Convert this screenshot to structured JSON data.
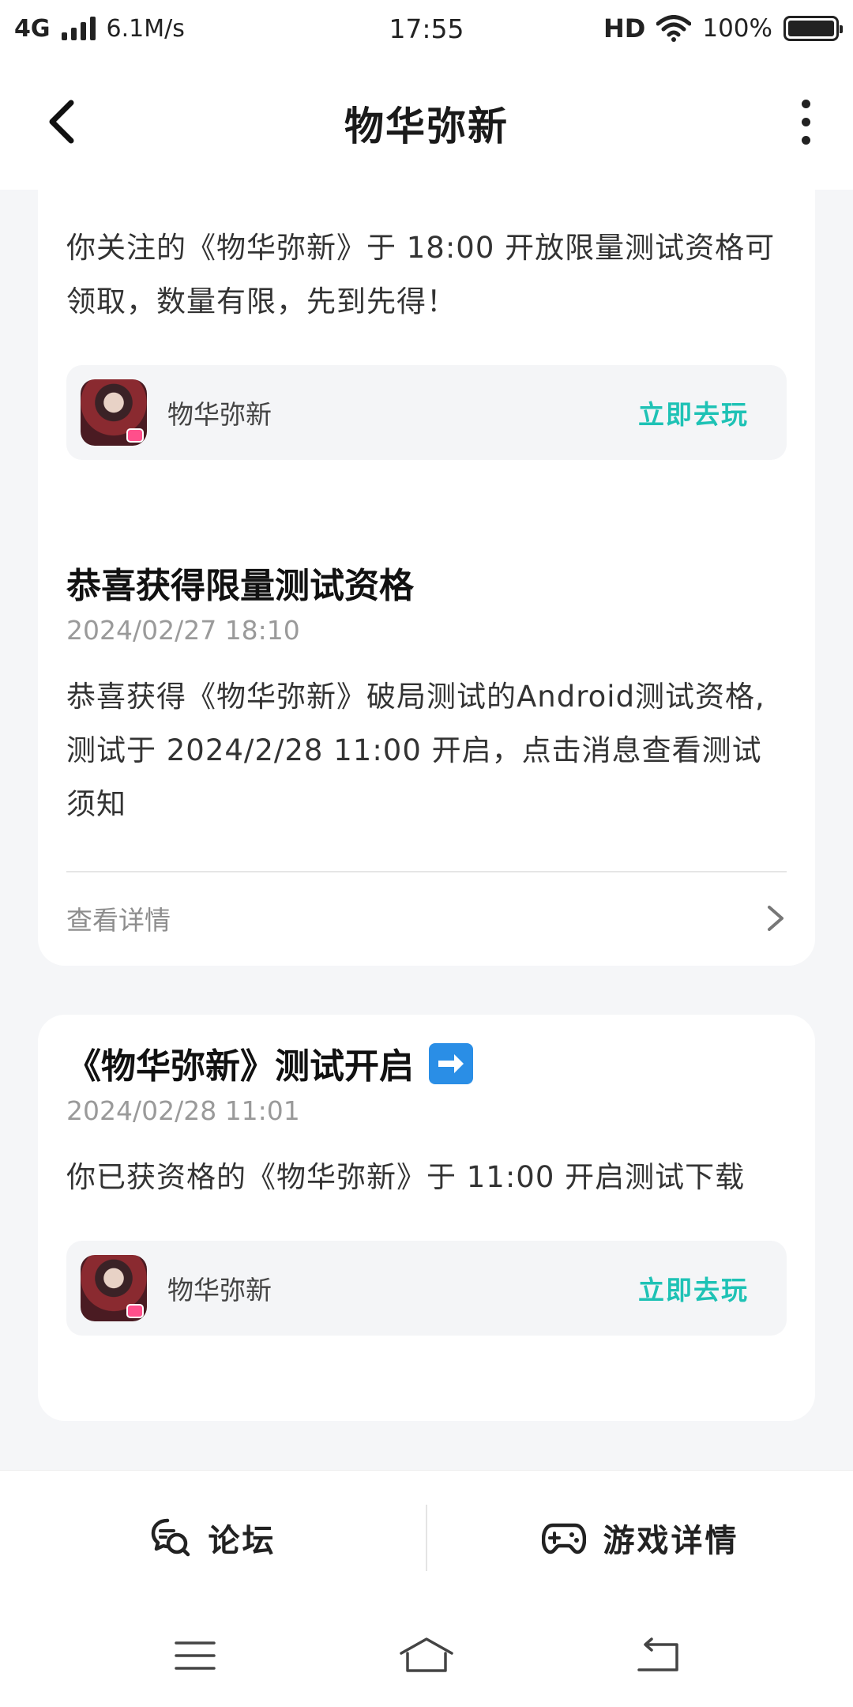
{
  "status_bar": {
    "network": "4G",
    "speed": "6.1M/s",
    "time": "17:55",
    "hd": "HD",
    "battery": "100%",
    "battery_level": 1.0
  },
  "header": {
    "title": "物华弥新"
  },
  "cards": [
    {
      "text": "你关注的《物华弥新》于 18:00 开放限量测试资格可领取，数量有限，先到先得！",
      "game_name": "物华弥新",
      "play_label": "立即去玩"
    },
    {
      "title": "恭喜获得限量测试资格",
      "date": "2024/02/27 18:10",
      "text": "恭喜获得《物华弥新》破局测试的Android测试资格,测试于 2024/2/28 11:00 开启，点击消息查看测试须知",
      "detail_label": "查看详情"
    },
    {
      "title": "《物华弥新》测试开启",
      "date": "2024/02/28 11:01",
      "text": "你已获资格的《物华弥新》于 11:00 开启测试下载",
      "game_name": "物华弥新",
      "play_label": "立即去玩"
    }
  ],
  "action_bar": {
    "forum_label": "论坛",
    "game_detail_label": "游戏详情"
  },
  "colors": {
    "accent": "#1ec2b5",
    "background": "#f5f6f8",
    "card": "#ffffff",
    "muted_text": "#9a9a9a"
  }
}
